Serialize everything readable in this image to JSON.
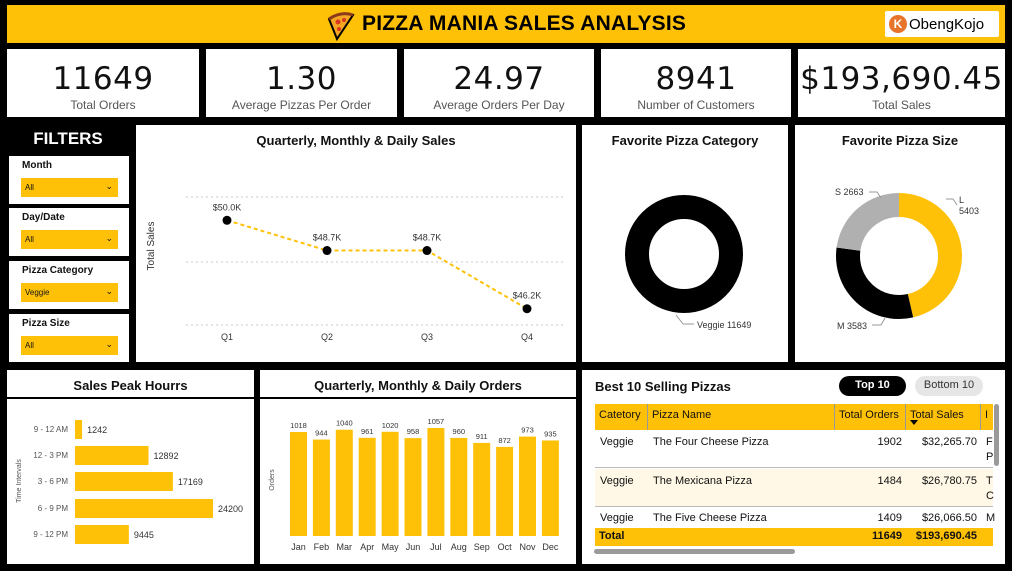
{
  "header": {
    "title": "PIZZA MANIA SALES ANALYSIS",
    "logo_letter": "K",
    "logo_text": "ObengKojo"
  },
  "kpis": [
    {
      "value": "11649",
      "label": "Total Orders"
    },
    {
      "value": "1.30",
      "label": "Average Pizzas Per Order"
    },
    {
      "value": "24.97",
      "label": "Average Orders Per Day"
    },
    {
      "value": "8941",
      "label": "Number of Customers"
    },
    {
      "value": "$193,690.45",
      "label": "Total Sales"
    }
  ],
  "filters": {
    "title": "FILTERS",
    "items": [
      {
        "label": "Month",
        "value": "All"
      },
      {
        "label": "Day/Date",
        "value": "All"
      },
      {
        "label": "Pizza Category",
        "value": "Veggie"
      },
      {
        "label": "Pizza Size",
        "value": "All"
      }
    ],
    "chevron": "⌄"
  },
  "panels": {
    "quarterly_sales": "Quarterly, Monthly & Daily Sales",
    "category": "Favorite Pizza Category",
    "size": "Favorite Pizza Size",
    "peak_hours": "Sales Peak Hourrs",
    "orders": "Quarterly, Monthly & Daily Orders",
    "best10": "Best 10 Selling Pizzas"
  },
  "best10_buttons": {
    "top": "Top 10",
    "bottom": "Bottom 10"
  },
  "table": {
    "headers": [
      "Catetory",
      "Pizza Name",
      "Total Orders",
      "Total Sales",
      "I"
    ],
    "rows": [
      {
        "category": "Veggie",
        "name": "The Four Cheese Pizza",
        "orders": "1902",
        "sales": "$32,265.70",
        "extra1": "F",
        "extra2": "P"
      },
      {
        "category": "Veggie",
        "name": "The Mexicana Pizza",
        "orders": "1484",
        "sales": "$26,780.75",
        "extra1": "T",
        "extra2": "C"
      },
      {
        "category": "Veggie",
        "name": "The Five Cheese Pizza",
        "orders": "1409",
        "sales": "$26,066.50",
        "extra1": "M",
        "extra2": ""
      }
    ],
    "total": {
      "label": "Total",
      "orders": "11649",
      "sales": "$193,690.45"
    }
  },
  "colors": {
    "accent": "#FFC107",
    "black": "#000000",
    "gray": "#B0B0B0"
  },
  "chart_data": [
    {
      "type": "line",
      "title": "Quarterly, Monthly & Daily Sales",
      "ylabel": "Total Sales",
      "categories": [
        "Q1",
        "Q2",
        "Q3",
        "Q4"
      ],
      "values": [
        50.0,
        48.7,
        48.7,
        46.2
      ],
      "data_labels": [
        "$50.0K",
        "$48.7K",
        "$48.7K",
        "$46.2K"
      ],
      "ylim": [
        45.5,
        51.0
      ]
    },
    {
      "type": "pie",
      "title": "Favorite Pizza Category",
      "slices": [
        {
          "label": "Veggie",
          "value": 11649
        }
      ],
      "slice_labels": [
        "Veggie 11649"
      ]
    },
    {
      "type": "pie",
      "title": "Favorite Pizza Size",
      "slices": [
        {
          "label": "L",
          "value": 5403,
          "color": "#FFC107"
        },
        {
          "label": "M",
          "value": 3583,
          "color": "#000000"
        },
        {
          "label": "S",
          "value": 2663,
          "color": "#B0B0B0"
        }
      ],
      "slice_labels": [
        "L",
        "5403",
        "M 3583",
        "S 2663"
      ]
    },
    {
      "type": "bar",
      "orientation": "horizontal",
      "title": "Sales Peak Hourrs",
      "ylabel": "Time Intervals",
      "categories": [
        "9 - 12 AM",
        "12 - 3 PM",
        "3 - 6 PM",
        "6 - 9 PM",
        "9 - 12 PM"
      ],
      "values": [
        1242,
        12892,
        17169,
        24200,
        9445
      ]
    },
    {
      "type": "bar",
      "title": "Quarterly, Monthly & Daily Orders",
      "ylabel": "Orders",
      "categories": [
        "Jan",
        "Feb",
        "Mar",
        "Apr",
        "May",
        "Jun",
        "Jul",
        "Aug",
        "Sep",
        "Oct",
        "Nov",
        "Dec"
      ],
      "values": [
        1018,
        944,
        1040,
        961,
        1020,
        958,
        1057,
        960,
        911,
        872,
        973,
        935
      ]
    }
  ]
}
